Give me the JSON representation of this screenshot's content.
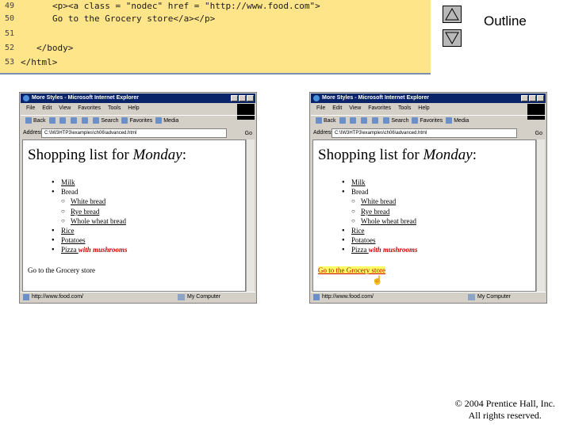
{
  "code": {
    "lines": [
      {
        "num": "49",
        "text": "<p><a class = \"nodec\" href = \"http://www.food.com\">"
      },
      {
        "num": "50",
        "text": "Go to the Grocery store</a></p>"
      },
      {
        "num": "51",
        "text": ""
      },
      {
        "num": "52",
        "text": "</body>"
      },
      {
        "num": "53",
        "text": "</html>"
      }
    ]
  },
  "outline": {
    "label": "Outline",
    "up_icon": "triangle-up-icon",
    "down_icon": "triangle-down-icon"
  },
  "browser": {
    "title": "More Styles - Microsoft Internet Explorer",
    "menu": [
      "File",
      "Edit",
      "View",
      "Favorites",
      "Tools",
      "Help"
    ],
    "toolbar": {
      "back": "Back",
      "search": "Search",
      "favorites": "Favorites",
      "media": "Media"
    },
    "address_label": "Address",
    "address_value": "C:\\IW3HTP3\\examples\\ch06\\advanced.html",
    "go": "Go",
    "status_zone": "My Computer",
    "status_url": "http://www.food.com/"
  },
  "page": {
    "heading_prefix": "Shopping list for ",
    "heading_day": "Monday",
    "heading_suffix": ":",
    "items": {
      "milk": "Milk",
      "bread": "Bread",
      "white": "White bread",
      "rye": "Rye bread",
      "wheat": "Whole wheat bread",
      "rice": "Rice",
      "potatoes": "Potatoes",
      "pizza": "Pizza ",
      "pizza_extra": "with mushrooms"
    },
    "grocery_link": "Go to the Grocery store"
  },
  "copyright": {
    "line1": "© 2004 Prentice Hall, Inc.",
    "line2": "All rights reserved."
  }
}
